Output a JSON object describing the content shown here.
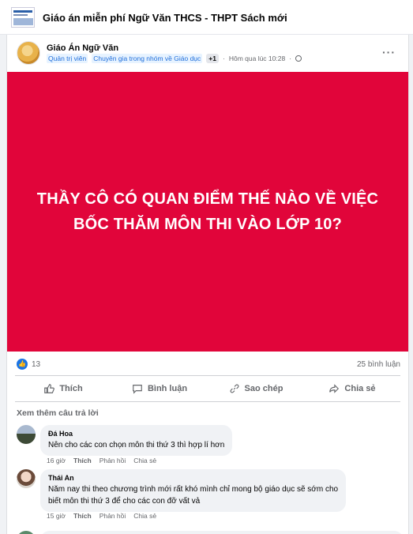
{
  "group": {
    "title": "Giáo án miễn phí Ngữ Văn THCS - THPT Sách mới"
  },
  "post": {
    "author": "Giáo Án Ngữ Văn",
    "badges": [
      "Quản trị viên",
      "Chuyên gia trong nhóm về Giáo dục"
    ],
    "extra_badges": "+1",
    "time": "Hôm qua lúc 10:28",
    "more": "···",
    "banner_lines": [
      "THẦY CÔ CÓ QUAN ĐIỂM THẾ NÀO VỀ VIỆC",
      "BỐC THĂM MÔN THI VÀO LỚP 10?"
    ],
    "banner_color": "#e1053a",
    "like_count": "13",
    "comment_count": "25 bình luận"
  },
  "actions": {
    "like": "Thích",
    "comment": "Bình luận",
    "copy": "Sao chép",
    "share": "Chia sẻ"
  },
  "comments_section": {
    "view_more": "Xem thêm câu trả lời",
    "items": [
      {
        "name": "Đá Hoa",
        "text_lines": [
          "Nên cho các con chọn môn thi thứ 3 thì hợp lí hơn"
        ],
        "time": "16 giờ",
        "like": "Thích",
        "reply": "Phản hồi",
        "share": "Chia sẻ"
      },
      {
        "name": "Thái An",
        "text_lines": [
          "Năm nay thi theo chương trình mới rất khó mình chỉ mong bộ giáo dục sẽ sớm cho",
          "biết môn thi thứ 3 để cho các con đỡ vất vả"
        ],
        "time": "15 giờ",
        "like": "Thích",
        "reply": "Phản hồi",
        "share": "Chia sẻ"
      }
    ]
  }
}
